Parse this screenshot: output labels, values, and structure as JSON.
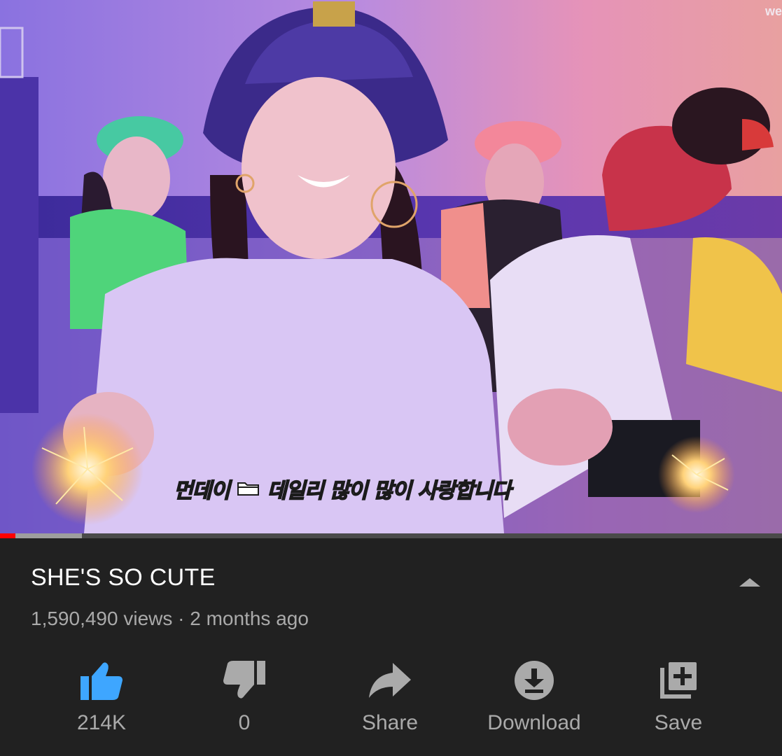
{
  "video": {
    "watermark": "we",
    "subtitle_name": "먼데이",
    "subtitle_text": "데일리 많이 많이 사랑합니다",
    "progress_played": 0.02,
    "progress_buffered": 0.105
  },
  "info": {
    "title": "SHE'S SO CUTE",
    "meta": "1,590,490 views · 2 months ago"
  },
  "actions": {
    "like_count": "214K",
    "dislike_count": "0",
    "share_label": "Share",
    "download_label": "Download",
    "save_label": "Save"
  },
  "colors": {
    "like_active": "#3ea6ff",
    "icon_inactive": "#aaaaaa",
    "background": "#212121",
    "progress_red": "#ff0000"
  },
  "icons": {
    "like": "thumbs-up-icon",
    "dislike": "thumbs-down-icon",
    "share": "share-arrow-icon",
    "download": "download-icon",
    "save": "playlist-add-icon",
    "expand": "chevron-up-icon"
  }
}
